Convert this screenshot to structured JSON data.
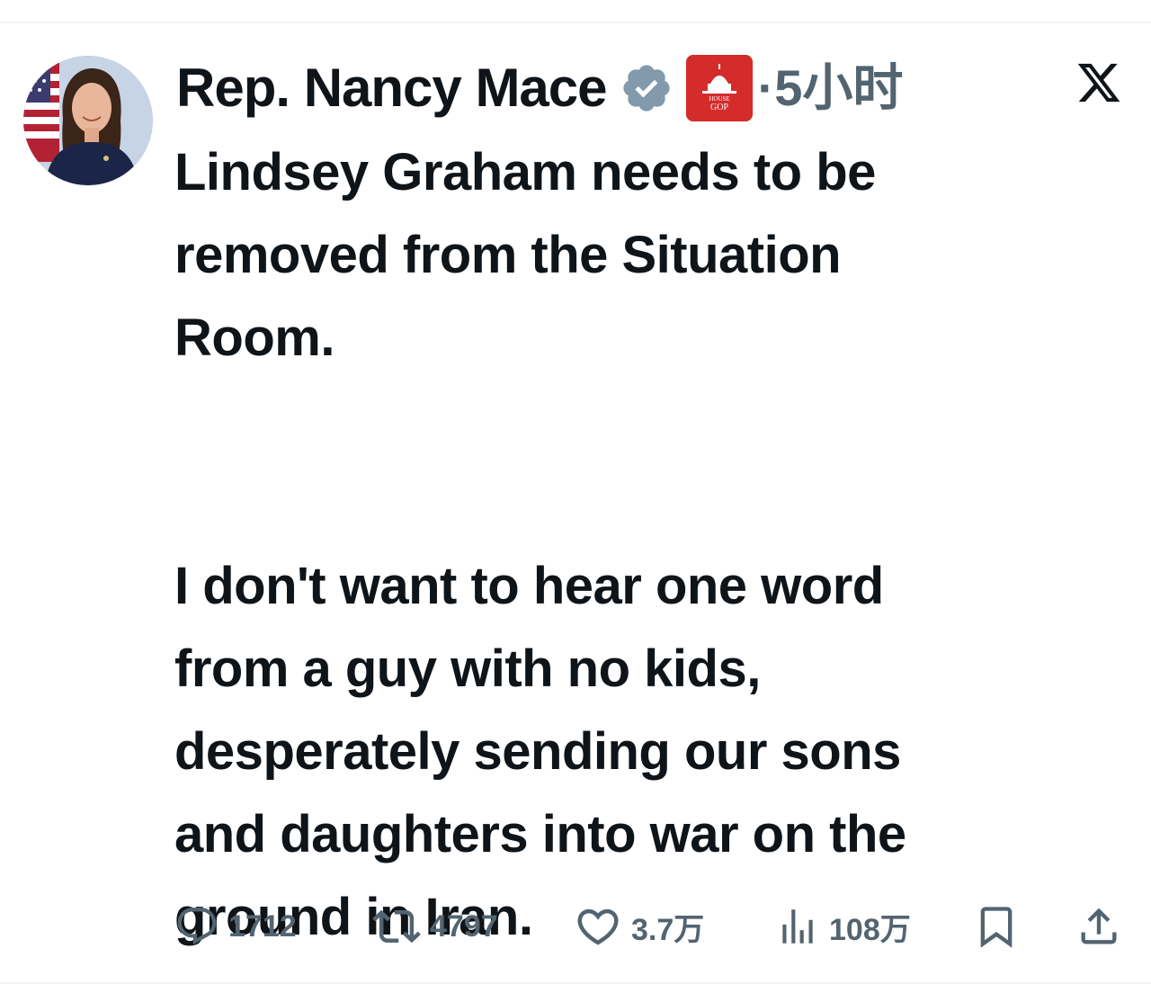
{
  "tweet": {
    "author": {
      "display_name": "Rep. Nancy Mace",
      "verified": true,
      "affiliation_badge_text": [
        "HOUSE",
        "GOP"
      ]
    },
    "timestamp": "·5小时",
    "text": "Lindsey Graham needs to be\nremoved from the Situation\nRoom.\n\n\nI don't want to hear one word\nfrom a guy with no kids,\ndesperately sending our sons\nand daughters into war on the\nground in Iran.",
    "metrics": {
      "replies": "1712",
      "reposts": "4797",
      "likes": "3.7万",
      "views": "108万"
    },
    "icons": {
      "reply": "reply-icon",
      "repost": "repost-icon",
      "like": "heart-icon",
      "views": "views-icon",
      "bookmark": "bookmark-icon",
      "share": "share-icon",
      "platform": "x-logo-icon",
      "verified": "verified-badge-icon"
    },
    "colors": {
      "text": "#0f1419",
      "secondary": "#536471",
      "verified_badge": "#829aab",
      "affiliation_badge": "#d42b2b"
    }
  }
}
